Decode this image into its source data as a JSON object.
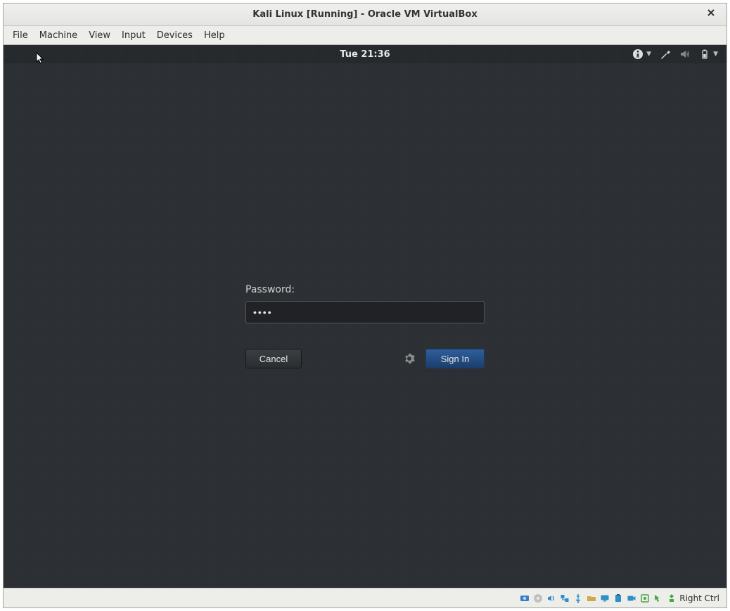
{
  "window": {
    "title": "Kali Linux [Running] - Oracle VM VirtualBox"
  },
  "menubar": {
    "items": [
      "File",
      "Machine",
      "View",
      "Input",
      "Devices",
      "Help"
    ]
  },
  "guest": {
    "clock": "Tue 21:36",
    "login": {
      "password_label": "Password:",
      "password_value": "••••",
      "cancel_label": "Cancel",
      "signin_label": "Sign In"
    },
    "tray": {
      "a11y_icon": "accessibility-icon",
      "tools_icon": "tools-icon",
      "volume_icon": "volume-icon",
      "battery_icon": "battery-icon"
    }
  },
  "statusbar": {
    "host_key_label": "Right Ctrl",
    "icons": [
      "hdd-icon",
      "cd-icon",
      "audio-icon",
      "net-icon",
      "usb-icon",
      "shared-folder-icon",
      "display-icon",
      "clipboard-icon",
      "record-icon",
      "vm-state-icon",
      "mouse-integration-icon",
      "host-key-icon"
    ]
  }
}
